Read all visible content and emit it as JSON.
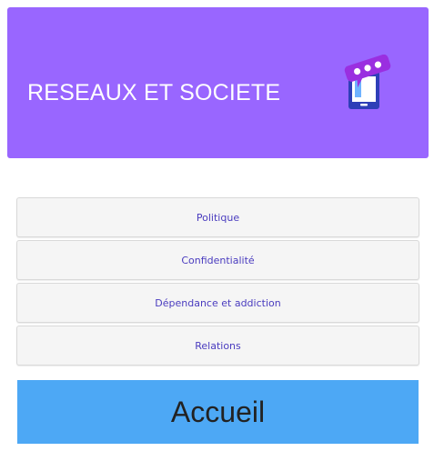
{
  "header": {
    "title": "RESEAUX ET SOCIETE",
    "background_color": "#9966ff",
    "logo_icon": "phone-chat-icon"
  },
  "menu": {
    "items": [
      {
        "label": "Politique"
      },
      {
        "label": "Confidentialité"
      },
      {
        "label": "Dépendance et addiction"
      },
      {
        "label": "Relations"
      }
    ],
    "text_color": "#4a3cbf"
  },
  "home_button": {
    "label": "Accueil",
    "background_color": "#4da8f5"
  }
}
